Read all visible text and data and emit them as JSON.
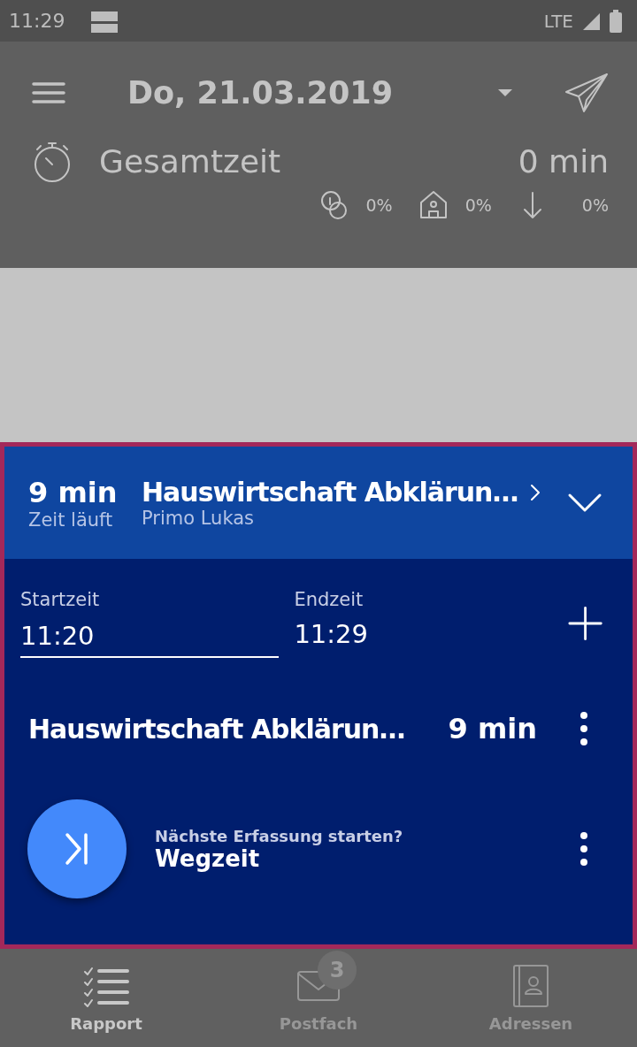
{
  "status_bar": {
    "time": "11:29",
    "network": "LTE"
  },
  "header": {
    "date": "Do, 21.03.2019",
    "total_label": "Gesamtzeit",
    "total_value": "0 min",
    "stats": [
      {
        "kind": "coins",
        "value": "0%"
      },
      {
        "kind": "home",
        "value": "0%"
      },
      {
        "kind": "down",
        "value": "0%"
      }
    ]
  },
  "current": {
    "duration": "9 min",
    "state": "Zeit läuft",
    "title": "Hauswirtschaft Abklärun…",
    "client": "Primo Lukas",
    "expanded": true,
    "start_label": "Startzeit",
    "start_value": "11:20",
    "end_label": "Endzeit",
    "end_value": "11:29",
    "entry": {
      "title": "Hauswirtschaft Abklärun…",
      "duration": "9 min"
    },
    "next": {
      "prompt": "Nächste Erfassung starten?",
      "title": "Wegzeit"
    }
  },
  "bottom_nav": [
    {
      "kind": "list",
      "label": "Rapport",
      "selected": true
    },
    {
      "kind": "mail",
      "label": "Postfach",
      "selected": false,
      "badge": "3"
    },
    {
      "kind": "book",
      "label": "Adressen",
      "selected": false
    }
  ]
}
